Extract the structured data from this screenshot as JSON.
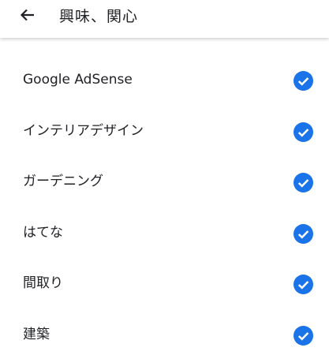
{
  "header": {
    "back_icon": "arrow-back-icon",
    "title": "興味、関心"
  },
  "colors": {
    "accent": "#1a73e8",
    "text": "#202124"
  },
  "interests": [
    {
      "label": "Google AdSense",
      "checked": true
    },
    {
      "label": "インテリアデザイン",
      "checked": true
    },
    {
      "label": "ガーデニング",
      "checked": true
    },
    {
      "label": "はてな",
      "checked": true
    },
    {
      "label": "間取り",
      "checked": true
    },
    {
      "label": "建築",
      "checked": true
    }
  ]
}
